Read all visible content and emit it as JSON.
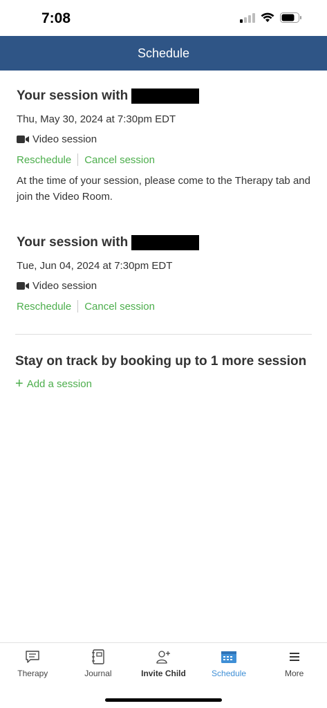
{
  "status": {
    "time": "7:08"
  },
  "header": {
    "title": "Schedule"
  },
  "sessions": [
    {
      "title": "Your session with",
      "date": "Thu, May 30, 2024 at 7:30pm EDT",
      "type": "Video session",
      "reschedule": "Reschedule",
      "cancel": "Cancel session",
      "note": "At the time of your session, please come to the Therapy tab and join the Video Room."
    },
    {
      "title": "Your session with",
      "date": "Tue, Jun 04, 2024 at 7:30pm EDT",
      "type": "Video session",
      "reschedule": "Reschedule",
      "cancel": "Cancel session"
    }
  ],
  "booking": {
    "prompt": "Stay on track by booking up to 1 more session",
    "add_label": "Add a session"
  },
  "tabs": [
    {
      "label": "Therapy",
      "icon": "chat-icon"
    },
    {
      "label": "Journal",
      "icon": "journal-icon"
    },
    {
      "label": "Invite Child",
      "icon": "add-person-icon"
    },
    {
      "label": "Schedule",
      "icon": "calendar-icon",
      "active": true
    },
    {
      "label": "More",
      "icon": "menu-icon"
    }
  ],
  "colors": {
    "header": "#2f5586",
    "link": "#4cae4c",
    "active_tab": "#3f8fd6"
  }
}
